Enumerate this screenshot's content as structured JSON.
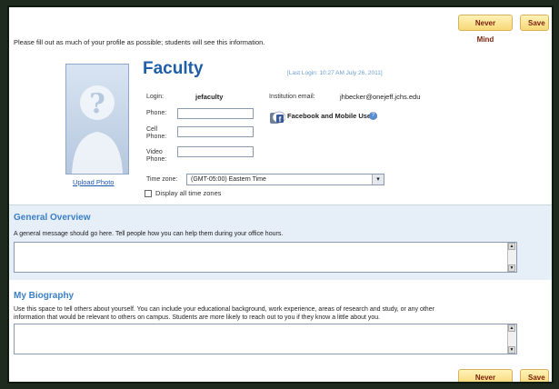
{
  "actions": {
    "never_mind": "Never Mind",
    "save": "Save"
  },
  "intro": "Please fill out as much of your profile as possible; students will see this information.",
  "profile": {
    "title": "Faculty",
    "last_login": "[Last Login: 10:27 AM July 26, 2011]",
    "upload_photo": "Upload Photo",
    "login_label": "Login:",
    "login_value": "jefaculty",
    "email_label": "Institution email:",
    "email_value": "jhbecker@onejeff.jchs.edu",
    "phone_label": "Phone:",
    "cell_label_1": "Cell",
    "cell_label_2": "Phone:",
    "video_label_1": "Video",
    "video_label_2": "Phone:",
    "timezone_label": "Time zone:",
    "timezone_value": "(GMT-05:00) Eastern Time",
    "display_all_tz": "Display all time zones",
    "facebook_label": "Facebook and Mobile Users"
  },
  "general_overview": {
    "title": "General Overview",
    "description": "A general message should go here. Tell people how you can help them during your office hours."
  },
  "biography": {
    "title": "My Biography",
    "description_1": "Use this space to tell others about yourself. You can include your educational background, work experience, areas of research and study, or any other",
    "description_2": "information that would be relevant to others on campus. Students are more likely to reach out to you if they know a little about you."
  },
  "colors": {
    "accent": "#1f5fa8",
    "section_bg": "#e6eef8",
    "button_bg": "#f7d878"
  },
  "icons": {
    "avatar": "person-silhouette-icon",
    "facebook": "facebook-phone-icon",
    "help": "help-icon"
  }
}
